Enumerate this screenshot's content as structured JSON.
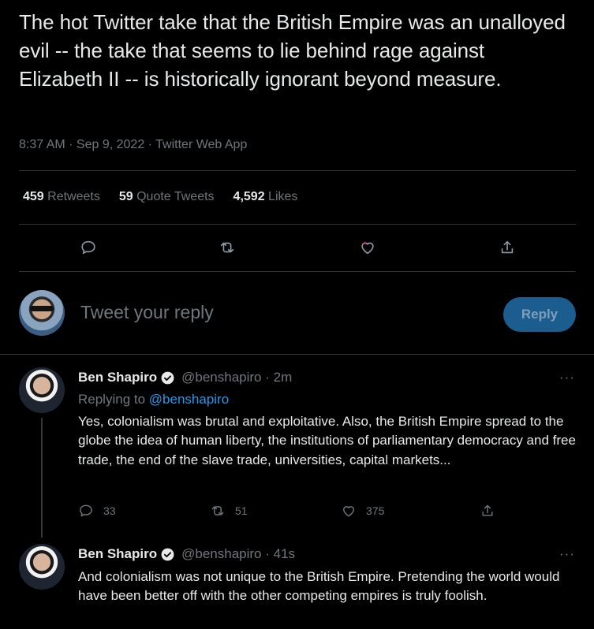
{
  "main_tweet": {
    "text": "The hot Twitter take that the British Empire was an unalloyed evil -- the take that seems to lie behind rage against Elizabeth II -- is historically ignorant beyond measure.",
    "meta": "8:37 AM · Sep 9, 2022 · Twitter Web App",
    "stats": {
      "retweets_count": "459",
      "retweets_label": "Retweets",
      "quotes_count": "59",
      "quotes_label": "Quote Tweets",
      "likes_count": "4,592",
      "likes_label": "Likes"
    },
    "icons": [
      "reply-icon",
      "retweet-icon",
      "like-icon",
      "share-icon"
    ]
  },
  "reply_composer": {
    "placeholder": "Tweet your reply",
    "button_label": "Reply",
    "button_color": "#1c5d8f"
  },
  "replies": [
    {
      "name": "Ben Shapiro",
      "handle": "@benshapiro · 2m",
      "more": "···",
      "replying_prefix": "Replying to",
      "replying_handle": "@benshapiro",
      "text": "Yes, colonialism was brutal and exploitative. Also, the British Empire spread to the globe the idea of human liberty, the institutions of parliamentary democracy and free trade, the end of the slave trade, universities, capital markets...",
      "reply_count": "33",
      "retweet_count": "51",
      "like_count": "375"
    },
    {
      "name": "Ben Shapiro",
      "handle": "@benshapiro · 41s",
      "more": "···",
      "text": "And colonialism was not unique to the British Empire. Pretending the world would have been better off with the other competing empires is truly foolish."
    }
  ],
  "colors": {
    "background": "#000000",
    "link": "#1d9bf0",
    "secondary_text": "#71767b",
    "like_notification_dot": "#f91880"
  }
}
